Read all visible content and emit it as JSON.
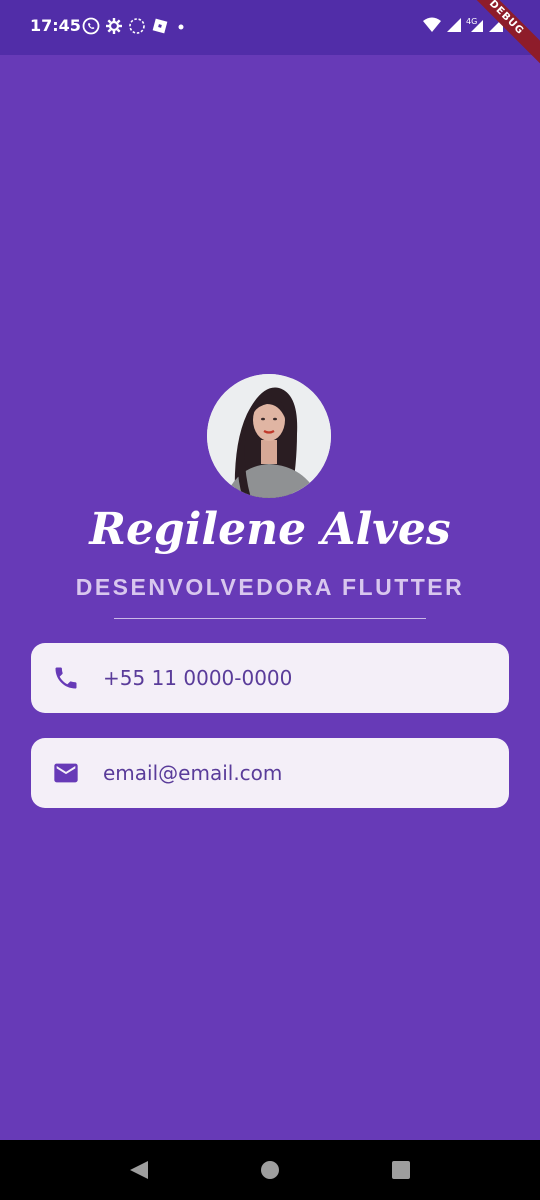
{
  "status_bar": {
    "time": "17:45",
    "left_icons": [
      "whatsapp-icon",
      "settings-icon",
      "sync-icon",
      "roblox-icon",
      "dot-icon"
    ],
    "right_icons": [
      "wifi-icon",
      "signal-icon",
      "4g-signal-icon",
      "signal-icon"
    ],
    "debug_label": "DEBUG"
  },
  "profile": {
    "name": "Regilene Alves",
    "title": "DESENVOLVEDORA FLUTTER"
  },
  "contacts": [
    {
      "icon": "phone-icon",
      "text": "+55 11 0000-0000"
    },
    {
      "icon": "email-icon",
      "text": "email@email.com"
    }
  ],
  "nav_bar": {
    "buttons": [
      "back-icon",
      "home-icon",
      "recents-icon"
    ]
  },
  "colors": {
    "background": "#673ab7",
    "status_bar": "#512da8",
    "card": "#f4eff8",
    "accent": "#673ab7"
  }
}
